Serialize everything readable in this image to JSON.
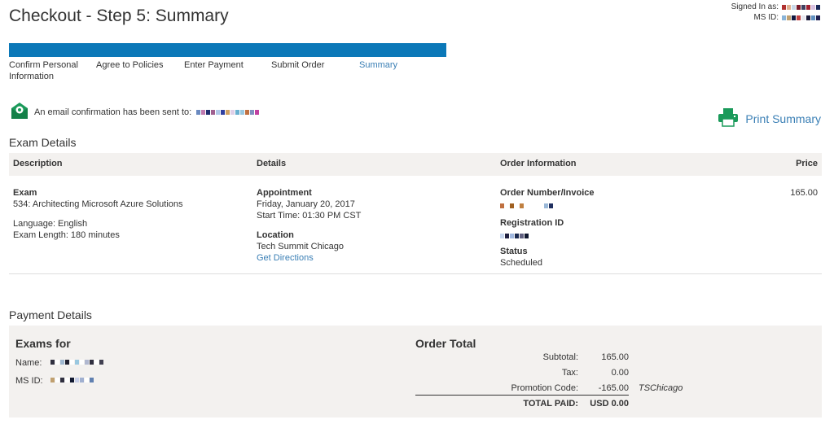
{
  "header": {
    "title": "Checkout - Step 5: Summary",
    "signed_in_label": "Signed In as:",
    "ms_id_label": "MS ID:"
  },
  "steps": [
    {
      "label": "Confirm Personal Information",
      "active": false
    },
    {
      "label": "Agree to Policies",
      "active": false
    },
    {
      "label": "Enter Payment",
      "active": false
    },
    {
      "label": "Submit Order",
      "active": false
    },
    {
      "label": "Summary",
      "active": true
    }
  ],
  "progress": 1.0,
  "confirmation": {
    "text": "An email confirmation has been sent to:"
  },
  "print": {
    "label": "Print Summary"
  },
  "exam_details": {
    "title": "Exam Details",
    "columns": [
      "Description",
      "Details",
      "Order Information",
      "Price"
    ],
    "exam_label": "Exam",
    "exam_name": "534: Architecting Microsoft Azure Solutions",
    "language": "Language: English",
    "exam_length": "Exam Length: 180 minutes",
    "appointment_label": "Appointment",
    "appointment_date": "Friday, January 20, 2017",
    "start_time": "Start Time: 01:30 PM CST",
    "location_label": "Location",
    "location_name": "Tech Summit Chicago",
    "directions_link": "Get Directions",
    "order_number_label": "Order Number/Invoice",
    "registration_id_label": "Registration ID",
    "status_label": "Status",
    "status_value": "Scheduled",
    "price": "165.00"
  },
  "payment_details": {
    "title": "Payment Details",
    "exams_for_title": "Exams for",
    "name_label": "Name:",
    "ms_id_label": "MS ID:",
    "order_total_title": "Order Total",
    "subtotal_label": "Subtotal:",
    "subtotal_value": "165.00",
    "tax_label": "Tax:",
    "tax_value": "0.00",
    "promo_label": "Promotion Code:",
    "promo_value": "-165.00",
    "promo_code": "TSChicago",
    "total_label": "TOTAL PAID:",
    "total_value": "USD 0.00"
  },
  "colors": {
    "accent": "#0b78b8",
    "link": "#3a7fb5",
    "icon_green": "#1a9a5a",
    "panel_bg": "#f3f1ef"
  }
}
